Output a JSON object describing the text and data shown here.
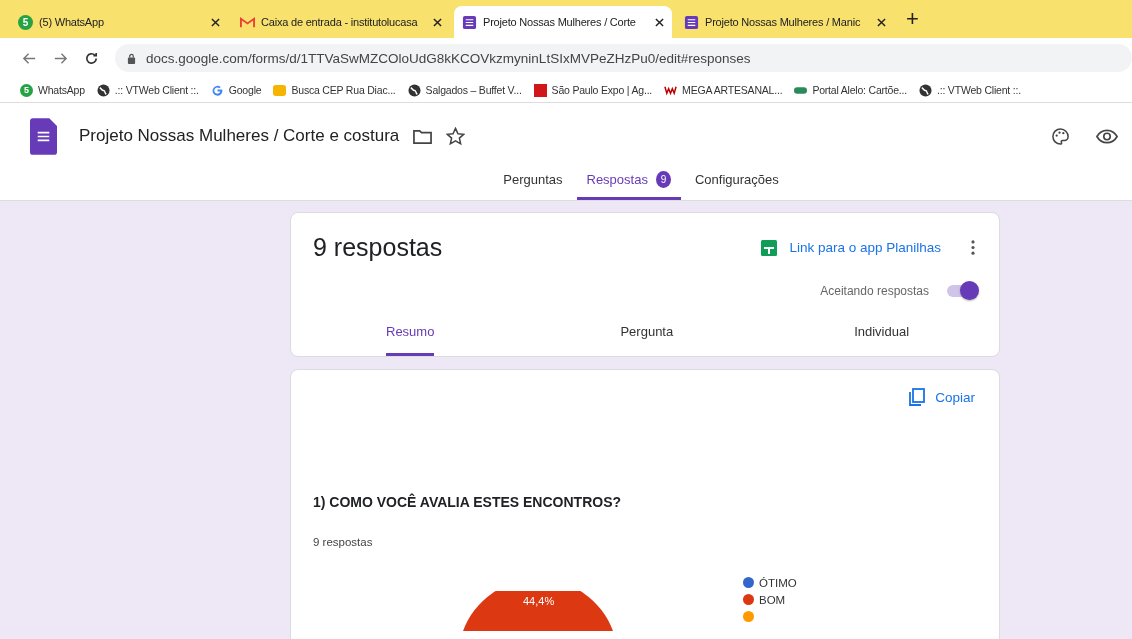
{
  "browser_tabs": [
    {
      "title": "(5) WhatsApp",
      "badge": "5",
      "selected": false
    },
    {
      "title": "Caixa de entrada - institutolucasa",
      "selected": false
    },
    {
      "title": "Projeto Nossas Mulheres / Corte",
      "selected": true
    },
    {
      "title": "Projeto Nossas Mulheres / Manic",
      "selected": false
    }
  ],
  "new_tab": "+",
  "address": "docs.google.com/forms/d/1TTVaSwMZCOloUdG8kKCOVkzmyninLtSIxMVPeZHzPu0/edit#responses",
  "bookmarks": [
    {
      "label": "WhatsApp",
      "badge": "5"
    },
    {
      "label": ".:: VTWeb Client ::."
    },
    {
      "label": "Google"
    },
    {
      "label": "Busca CEP Rua Diac..."
    },
    {
      "label": "Salgados – Buffet V..."
    },
    {
      "label": "São Paulo Expo | Ag..."
    },
    {
      "label": "MEGA ARTESANAL..."
    },
    {
      "label": "Portal Alelo: Cartõe..."
    },
    {
      "label": ".:: VTWeb Client ::."
    }
  ],
  "form_title": "Projeto Nossas Mulheres / Corte e costura",
  "form_tabs": [
    {
      "label": "Perguntas",
      "selected": false
    },
    {
      "label": "Respostas",
      "count": "9",
      "selected": true
    },
    {
      "label": "Configurações",
      "selected": false
    }
  ],
  "summary_card": {
    "heading": "9 respostas",
    "sheets_link": "Link para o app Planilhas",
    "accepting_label": "Aceitando respostas",
    "accepting_on": true,
    "view_tabs": [
      {
        "label": "Resumo",
        "selected": true
      },
      {
        "label": "Pergunta",
        "selected": false
      },
      {
        "label": "Individual",
        "selected": false
      }
    ]
  },
  "question_card": {
    "copy_button": "Copiar",
    "question": "1) COMO VOCÊ AVALIA ESTES ENCONTROS?",
    "responses": "9 respostas",
    "pie_label": "44,4%",
    "legend": [
      {
        "label": "ÓTIMO",
        "color": "#3366cc"
      },
      {
        "label": "BOM",
        "color": "#dc3912"
      },
      {
        "color": "#ff9900"
      }
    ]
  }
}
